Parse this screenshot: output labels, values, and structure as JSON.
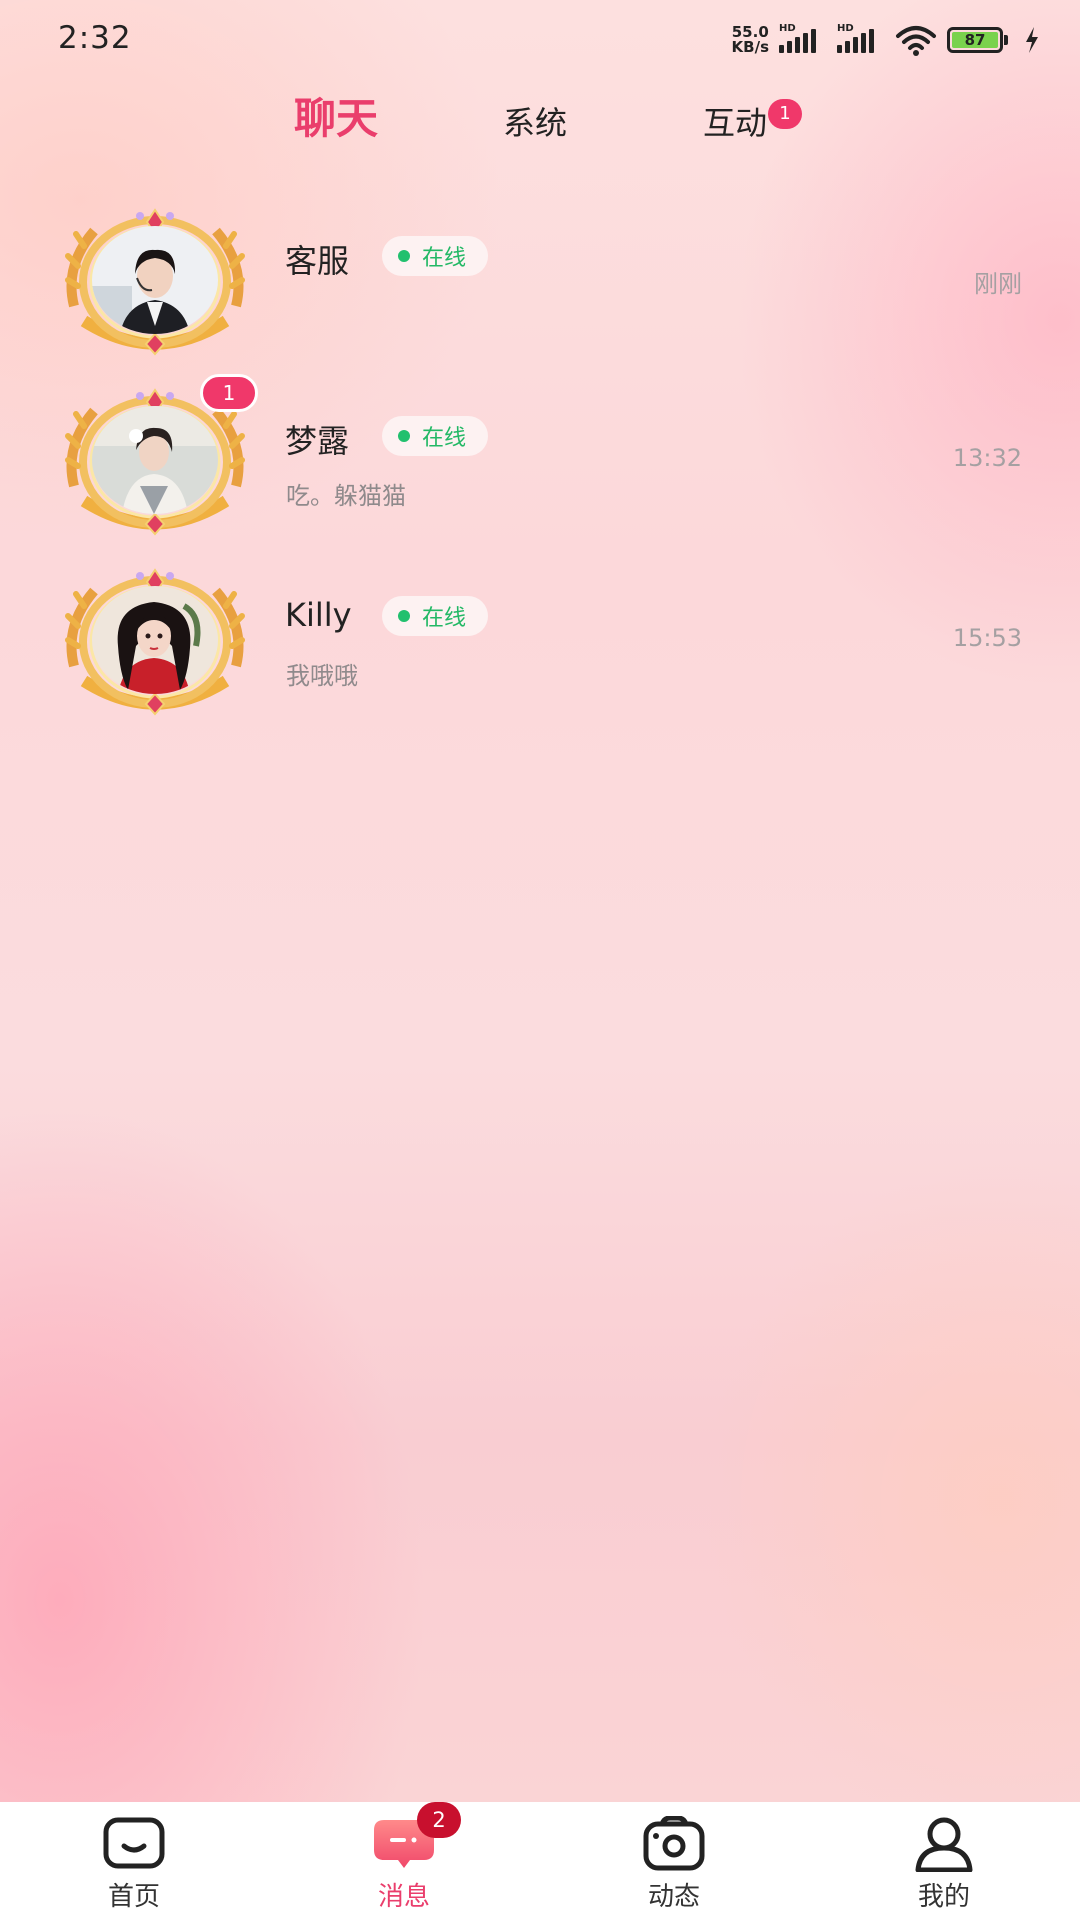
{
  "status_bar": {
    "time": "2:32",
    "net_speed_value": "55.0",
    "net_speed_unit": "KB/s",
    "signal_label": "HD",
    "battery_level": "87",
    "icons": [
      "signal-icon",
      "signal-icon",
      "wifi-icon",
      "battery-icon",
      "charging-icon"
    ]
  },
  "tabs": [
    {
      "label": "聊天",
      "active": true
    },
    {
      "label": "系统",
      "active": false
    },
    {
      "label": "互动",
      "active": false,
      "badge": "1"
    }
  ],
  "conversations": [
    {
      "name": "客服",
      "status": "在线",
      "preview": "",
      "time": "刚刚",
      "unread": ""
    },
    {
      "name": "梦露",
      "status": "在线",
      "preview": "吃。躲猫猫",
      "time": "13:32",
      "unread": "1"
    },
    {
      "name": "Killy",
      "status": "在线",
      "preview": "我哦哦",
      "time": "15:53",
      "unread": ""
    }
  ],
  "bottom_nav": {
    "items": [
      {
        "label": "首页",
        "icon": "home-icon",
        "active": false
      },
      {
        "label": "消息",
        "icon": "message-icon",
        "active": true,
        "badge": "2"
      },
      {
        "label": "动态",
        "icon": "camera-icon",
        "active": false
      },
      {
        "label": "我的",
        "icon": "profile-icon",
        "active": false
      }
    ]
  },
  "colors": {
    "accent": "#ea3e6c",
    "badge": "#f0386a",
    "online": "#22b865",
    "nav_badge": "#c8102e"
  }
}
